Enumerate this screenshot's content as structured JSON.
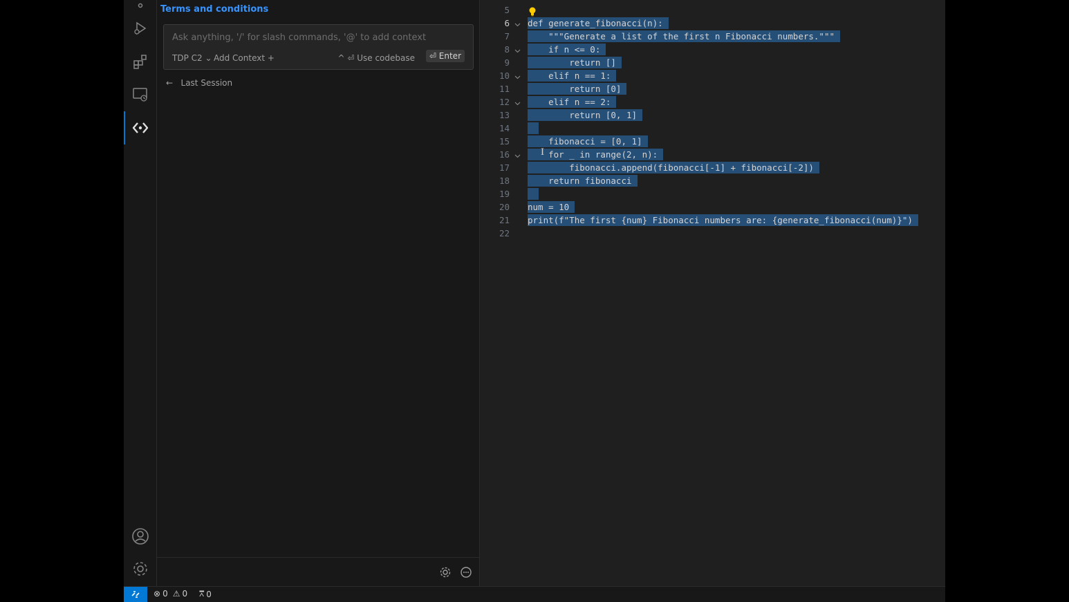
{
  "sidebar": {
    "terms_link": "Terms and conditions",
    "chat": {
      "placeholder": "Ask anything, '/' for slash commands, '@' to add context",
      "model": "TDP C2",
      "add_context": "Add Context",
      "use_codebase": "^ ⏎ Use codebase",
      "enter": "⏎ Enter"
    },
    "last_session": "Last Session"
  },
  "editor": {
    "lines": [
      {
        "num": "5",
        "text": "",
        "bulb": true
      },
      {
        "num": "6",
        "text": "def generate_fibonacci(n):",
        "fold": true,
        "active": true
      },
      {
        "num": "7",
        "text": "    \"\"\"Generate a list of the first n Fibonacci numbers.\"\"\""
      },
      {
        "num": "8",
        "text": "    if n <= 0:",
        "fold": true
      },
      {
        "num": "9",
        "text": "        return []"
      },
      {
        "num": "10",
        "text": "    elif n == 1:",
        "fold": true
      },
      {
        "num": "11",
        "text": "        return [0]"
      },
      {
        "num": "12",
        "text": "    elif n == 2:",
        "fold": true
      },
      {
        "num": "13",
        "text": "        return [0, 1]"
      },
      {
        "num": "14",
        "text": " "
      },
      {
        "num": "15",
        "text": "    fibonacci = [0, 1]"
      },
      {
        "num": "16",
        "text": "    for _ in range(2, n):",
        "fold": true
      },
      {
        "num": "17",
        "text": "        fibonacci.append(fibonacci[-1] + fibonacci[-2])"
      },
      {
        "num": "18",
        "text": "    return fibonacci"
      },
      {
        "num": "19",
        "text": " "
      },
      {
        "num": "20",
        "text": "num = 10"
      },
      {
        "num": "21",
        "text": "print(f\"The first {num} Fibonacci numbers are: {generate_fibonacci(num)}\")"
      },
      {
        "num": "22",
        "text": ""
      }
    ]
  },
  "status": {
    "errors": "0",
    "warnings": "0",
    "ports": "0"
  },
  "colors": {
    "accent": "#0078d4",
    "selection": "#264f78",
    "link": "#3794ff"
  },
  "icons": {
    "activity": [
      "run-debug-icon",
      "extensions-icon",
      "remote-explorer-icon",
      "code-assistant-icon",
      "account-icon",
      "settings-gear-icon"
    ]
  }
}
